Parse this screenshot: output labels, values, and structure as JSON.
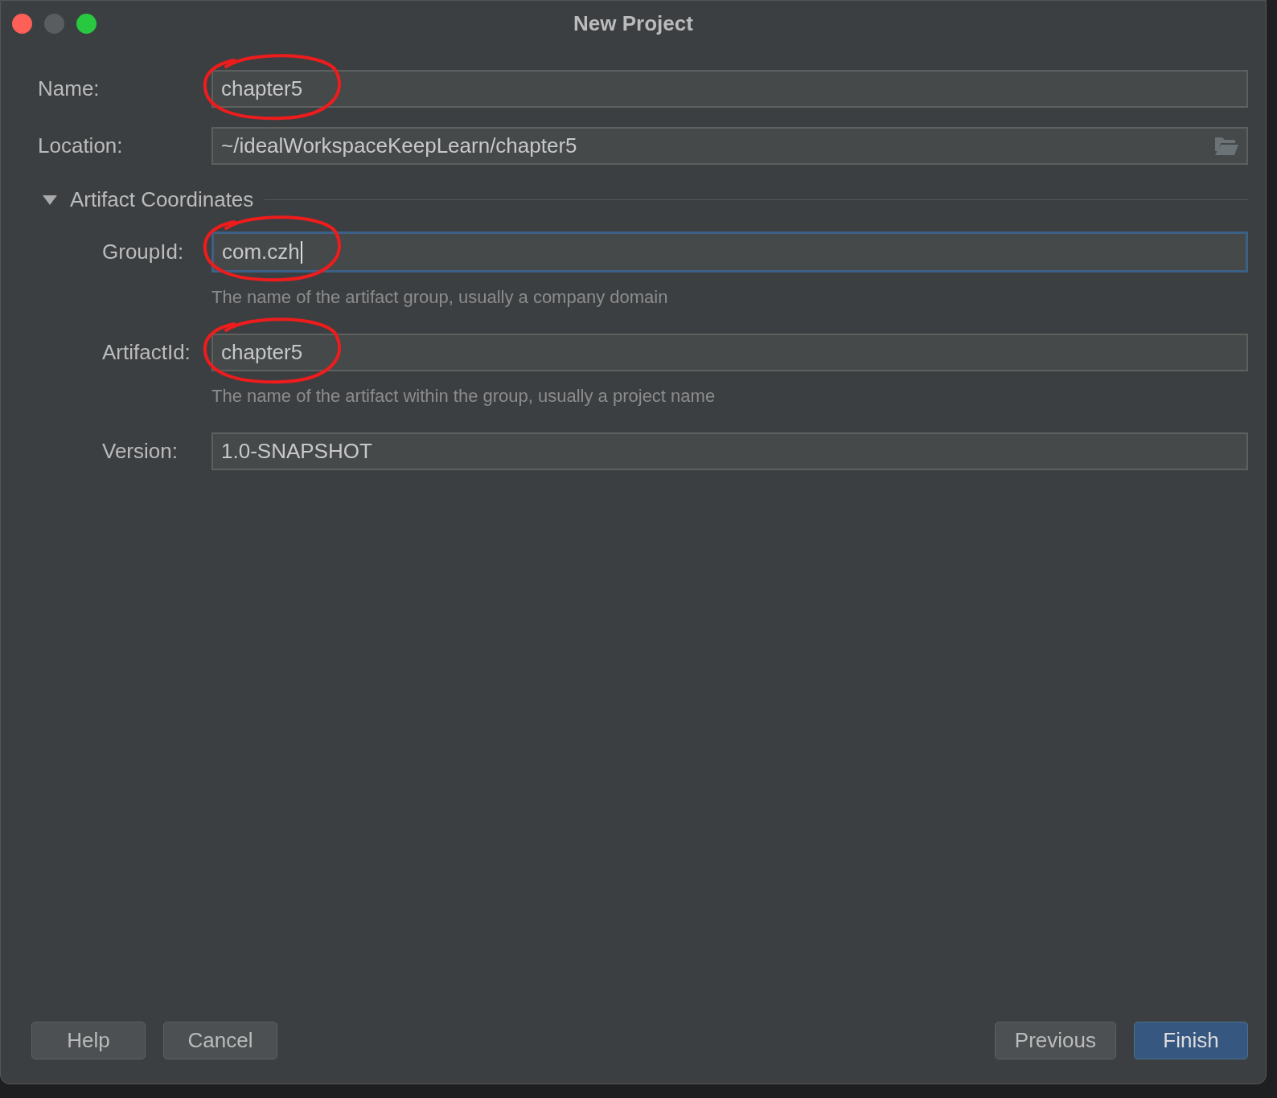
{
  "window": {
    "title": "New Project"
  },
  "fields": [
    {
      "label": "Name:",
      "value": "chapter5",
      "focused": false,
      "browse": false,
      "annotated": true
    },
    {
      "label": "Location:",
      "value": "~/idealWorkspaceKeepLearn/chapter5",
      "focused": false,
      "browse": true,
      "annotated": false
    }
  ],
  "section": {
    "title": "Artifact Coordinates",
    "expanded": true,
    "fields": [
      {
        "label": "GroupId:",
        "value": "com.czh",
        "focused": true,
        "annotated": true,
        "hint": "The name of the artifact group, usually a company domain"
      },
      {
        "label": "ArtifactId:",
        "value": "chapter5",
        "focused": false,
        "annotated": true,
        "hint": "The name of the artifact within the group, usually a project name"
      },
      {
        "label": "Version:",
        "value": "1.0-SNAPSHOT",
        "focused": false,
        "annotated": false
      }
    ]
  },
  "buttons_left": [
    {
      "label": "Help",
      "kind": "default"
    },
    {
      "label": "Cancel",
      "kind": "default"
    }
  ],
  "buttons_right": [
    {
      "label": "Previous",
      "kind": "default"
    },
    {
      "label": "Finish",
      "kind": "primary"
    }
  ]
}
